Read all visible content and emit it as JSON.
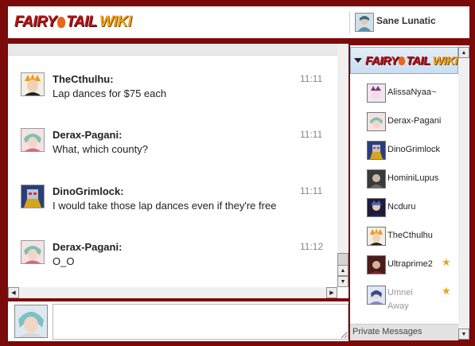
{
  "header": {
    "logo_text_1": "FAIRY",
    "logo_text_2": "TAIL",
    "logo_text_3": "WIKI",
    "current_user": "Sane Lunatic"
  },
  "messages": [
    {
      "user": "TheCthulhu:",
      "text": "Lap dances for $75 each",
      "time": "11:11"
    },
    {
      "user": "Derax-Pagani:",
      "text": "What, which county?",
      "time": "11:11"
    },
    {
      "user": "DinoGrimlock:",
      "text": "I would take those lap dances even if they're free",
      "time": "11:11"
    },
    {
      "user": "Derax-Pagani:",
      "text": "O_O",
      "time": "11:12"
    }
  ],
  "input": {
    "placeholder": ""
  },
  "userlist": {
    "users": [
      {
        "name": "AlissaNyaa~",
        "status": ""
      },
      {
        "name": "Derax-Pagani",
        "status": ""
      },
      {
        "name": "DinoGrimlock",
        "status": ""
      },
      {
        "name": "HominiLupus",
        "status": ""
      },
      {
        "name": "Ncduru",
        "status": ""
      },
      {
        "name": "TheCthulhu",
        "status": ""
      },
      {
        "name": "Ultraprime2",
        "status": ""
      },
      {
        "name": "Umnei",
        "status": "Away"
      }
    ],
    "private_messages_label": "Private Messages"
  },
  "icons": {
    "scroll_up": "▲",
    "scroll_down": "▼",
    "scroll_left": "◀",
    "scroll_right": "▶",
    "star": "★"
  },
  "colors": {
    "frame": "#7b0a0a",
    "logo_red": "#b01818",
    "logo_orange": "#f2a51c",
    "star": "#f0a020"
  }
}
